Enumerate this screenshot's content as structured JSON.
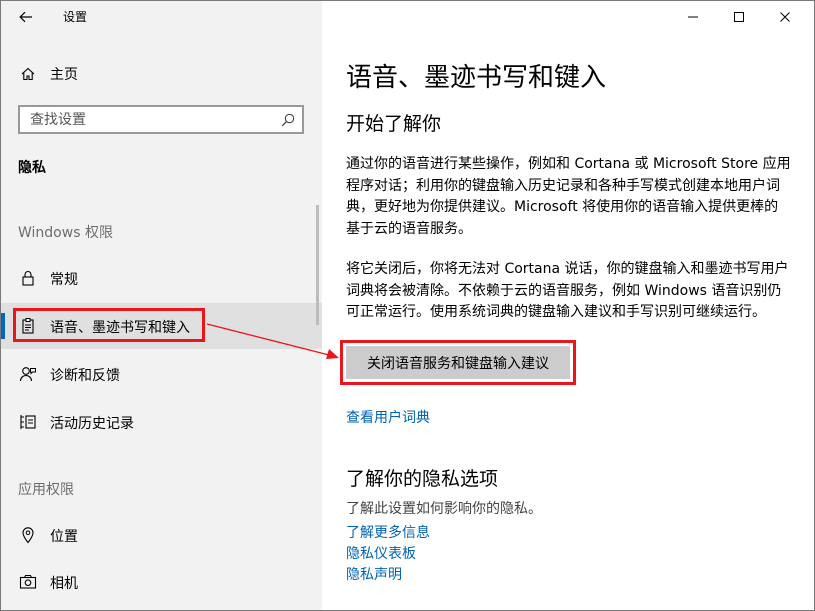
{
  "window": {
    "title": "设置",
    "controls": [
      "minimize-icon",
      "maximize-icon",
      "close-icon"
    ]
  },
  "sidebar": {
    "home_label": "主页",
    "search_placeholder": "查找设置",
    "category": "隐私",
    "windows_permissions_header": "Windows 权限",
    "windows_items": [
      {
        "label": "常规",
        "icon": "lock-icon"
      },
      {
        "label": "语音、墨迹书写和键入",
        "icon": "clipboard-icon",
        "selected": true
      },
      {
        "label": "诊断和反馈",
        "icon": "person-feedback-icon"
      },
      {
        "label": "活动历史记录",
        "icon": "activity-history-icon"
      }
    ],
    "app_permissions_header": "应用权限",
    "app_items": [
      {
        "label": "位置",
        "icon": "location-icon"
      },
      {
        "label": "相机",
        "icon": "camera-icon"
      }
    ]
  },
  "main": {
    "title": "语音、墨迹书写和键入",
    "section_title": "开始了解你",
    "paragraph1": "通过你的语音进行某些操作，例如和 Cortana 或 Microsoft Store 应用程序对话；利用你的键盘输入历史记录和各种手写模式创建本地用户词典，更好地为你提供建议。Microsoft 将使用你的语音输入提供更棒的基于云的语音服务。",
    "paragraph2": "将它关闭后，你将无法对 Cortana 说话，你的键盘输入和墨迹书写用户词典将会被清除。不依赖于云的语音服务，例如 Windows 语音识别仍可正常运行。使用系统词典的键盘输入建议和手写识别可继续运行。",
    "action_button": "关闭语音服务和键盘输入建议",
    "view_dictionary_link": "查看用户词典",
    "privacy_section_title": "了解你的隐私选项",
    "privacy_desc": "了解此设置如何影响你的隐私。",
    "links": [
      "了解更多信息",
      "隐私仪表板",
      "隐私声明"
    ]
  },
  "colors": {
    "accent": "#0067c0",
    "link": "#0063b1",
    "annotation_red": "#e8171c",
    "sidebar_bg": "#f2f2f2"
  }
}
